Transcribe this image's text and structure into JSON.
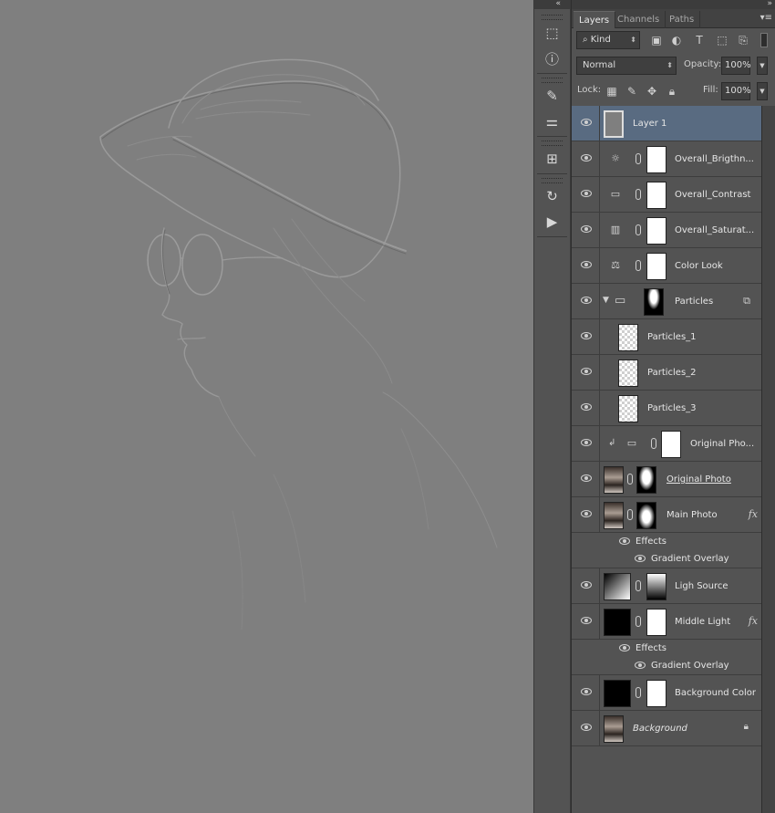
{
  "panel": {
    "tabs": [
      {
        "label": "Layers",
        "active": true
      },
      {
        "label": "Channels",
        "active": false
      },
      {
        "label": "Paths",
        "active": false
      }
    ],
    "filter_kind": "Kind",
    "blend_mode": "Normal",
    "opacity_label": "Opacity:",
    "opacity_value": "100%",
    "lock_label": "Lock:",
    "fill_label": "Fill:",
    "fill_value": "100%"
  },
  "layers": [
    {
      "name": "Layer 1",
      "selected": true
    },
    {
      "name": "Overall_Brigthn..."
    },
    {
      "name": "Overall_Contrast"
    },
    {
      "name": "Overall_Saturat..."
    },
    {
      "name": "Color Look"
    },
    {
      "name": "Particles"
    },
    {
      "name": "Particles_1"
    },
    {
      "name": "Particles_2"
    },
    {
      "name": "Particles_3"
    },
    {
      "name": "Original Pho..."
    },
    {
      "name": "Original Photo"
    },
    {
      "name": "Main Photo",
      "fx": "fx",
      "effects_label": "Effects",
      "effect": "Gradient Overlay"
    },
    {
      "name": "Ligh Source"
    },
    {
      "name": "Middle Light",
      "fx": "fx",
      "effects_label": "Effects",
      "effect": "Gradient Overlay"
    },
    {
      "name": "Background Color"
    },
    {
      "name": "Background"
    }
  ],
  "colors": {
    "canvas": "#7f7f7f",
    "panel": "#535353",
    "selected_row": "#596b81"
  }
}
